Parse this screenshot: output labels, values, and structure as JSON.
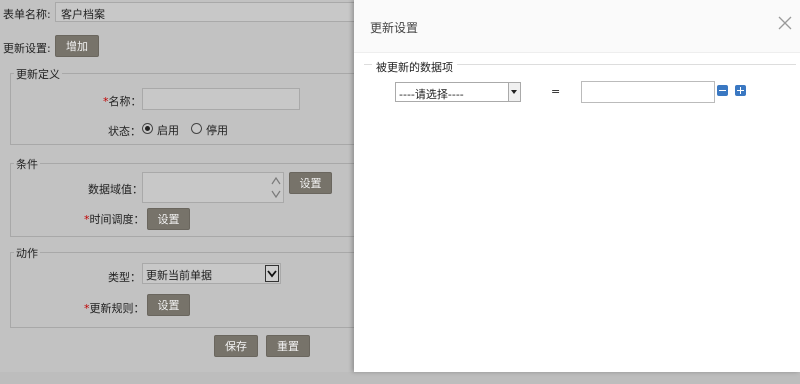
{
  "form": {
    "form_name_label": "表单名称:",
    "form_name_value": "客户档案",
    "update_setting_label": "更新设置:",
    "add_button": "增加",
    "group_definition": "更新定义",
    "name_label": "名称：",
    "name_req": "*",
    "status_label": "状态：",
    "status_enable": "启用",
    "status_disable": "停用",
    "status_selected": "启用",
    "group_condition": "条件",
    "data_domain_label": "数据域值：",
    "set_button_1": "设置",
    "time_schedule_req": "*",
    "time_schedule_label": "时间调度：",
    "set_button_2": "设置",
    "group_action": "动作",
    "type_label": "类型：",
    "type_value": "更新当前单据",
    "update_rule_req": "*",
    "update_rule_label": "更新规则：",
    "set_button_3": "设置",
    "save_button": "保存",
    "reset_button": "重置"
  },
  "modal": {
    "title": "更新设置",
    "fieldset_legend": "被更新的数据项",
    "select_value": "----请选择----",
    "equals": "=",
    "input_value": "",
    "accent": "#3a78c2"
  }
}
